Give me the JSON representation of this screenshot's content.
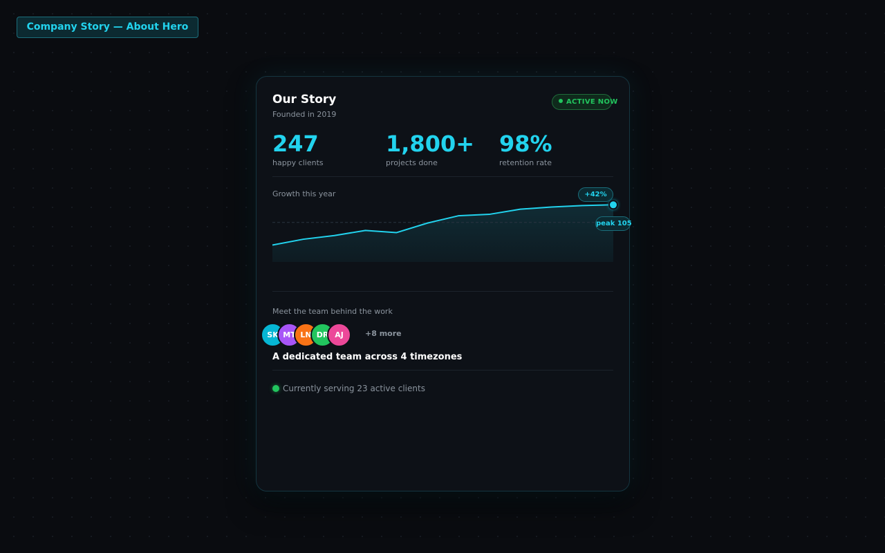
{
  "page_tag": "Company Story — About Hero",
  "card": {
    "title": "Our Story",
    "subtitle": "Founded in 2019",
    "status": "ACTIVE NOW",
    "stats": [
      {
        "value": "247",
        "label": "happy clients"
      },
      {
        "value": "1,800+",
        "label": "projects done"
      },
      {
        "value": "98%",
        "label": "retention rate"
      }
    ],
    "growth": {
      "label": "Growth this year",
      "badge": "+42%",
      "peak_label": "peak 105"
    },
    "team": {
      "label": "Meet the team behind the work",
      "avatars": [
        {
          "initials": "SK",
          "color": "#06b6d4"
        },
        {
          "initials": "MT",
          "color": "#a855f7"
        },
        {
          "initials": "LN",
          "color": "#f97316"
        },
        {
          "initials": "DR",
          "color": "#22c55e"
        },
        {
          "initials": "AJ",
          "color": "#ec4899"
        }
      ],
      "more": "+8 more",
      "tagline": "A dedicated team across 4 timezones"
    },
    "serving": "Currently serving 23 active clients"
  },
  "chart_data": {
    "type": "area",
    "title": "Growth this year",
    "x": [
      1,
      2,
      3,
      4,
      5,
      6,
      7,
      8,
      9,
      10,
      11,
      12
    ],
    "values": [
      50,
      58,
      63,
      70,
      67,
      80,
      90,
      92,
      99,
      102,
      104,
      105
    ],
    "reference_line": 81,
    "ylim": [
      25,
      110
    ],
    "grid": false,
    "line_color": "#22d3ee"
  }
}
